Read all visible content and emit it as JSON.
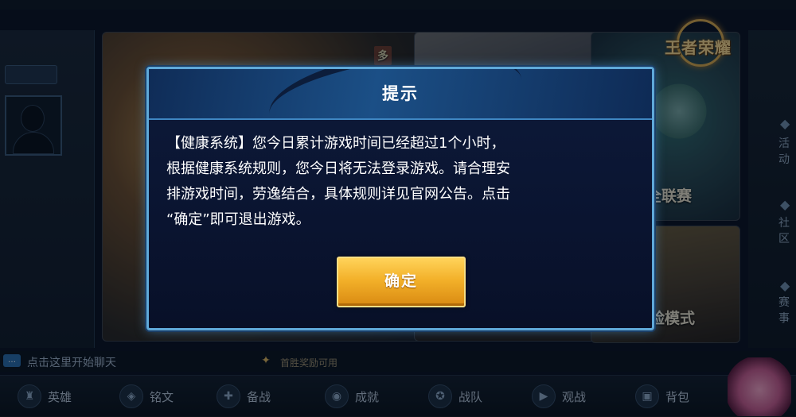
{
  "background": {
    "chat_prompt": "点击这里开始聊天",
    "reward_label": "首胜奖励可用",
    "card_labels": {
      "multi": "多",
      "league": "全联赛",
      "mode": "险模式"
    },
    "logo_text": "王者荣耀",
    "side_labels": [
      "活动",
      "社区",
      "赛事"
    ],
    "bottom_nav": [
      "英雄",
      "铭文",
      "备战",
      "成就",
      "战队",
      "观战",
      "背包"
    ]
  },
  "dialog": {
    "title": "提示",
    "body_lines": [
      "【健康系统】您今日累计游戏时间已经超过1个小时，",
      "根据健康系统规则，您今日将无法登录游戏。请合理安",
      "排游戏时间，劳逸结合，具体规则详见官网公告。点击",
      "“确定”即可退出游戏。"
    ],
    "confirm_label": "确定"
  },
  "colors": {
    "dialog_border": "#5fa9d9",
    "dialog_bg": "#0a1430",
    "button_gold": "#f3b12a"
  }
}
